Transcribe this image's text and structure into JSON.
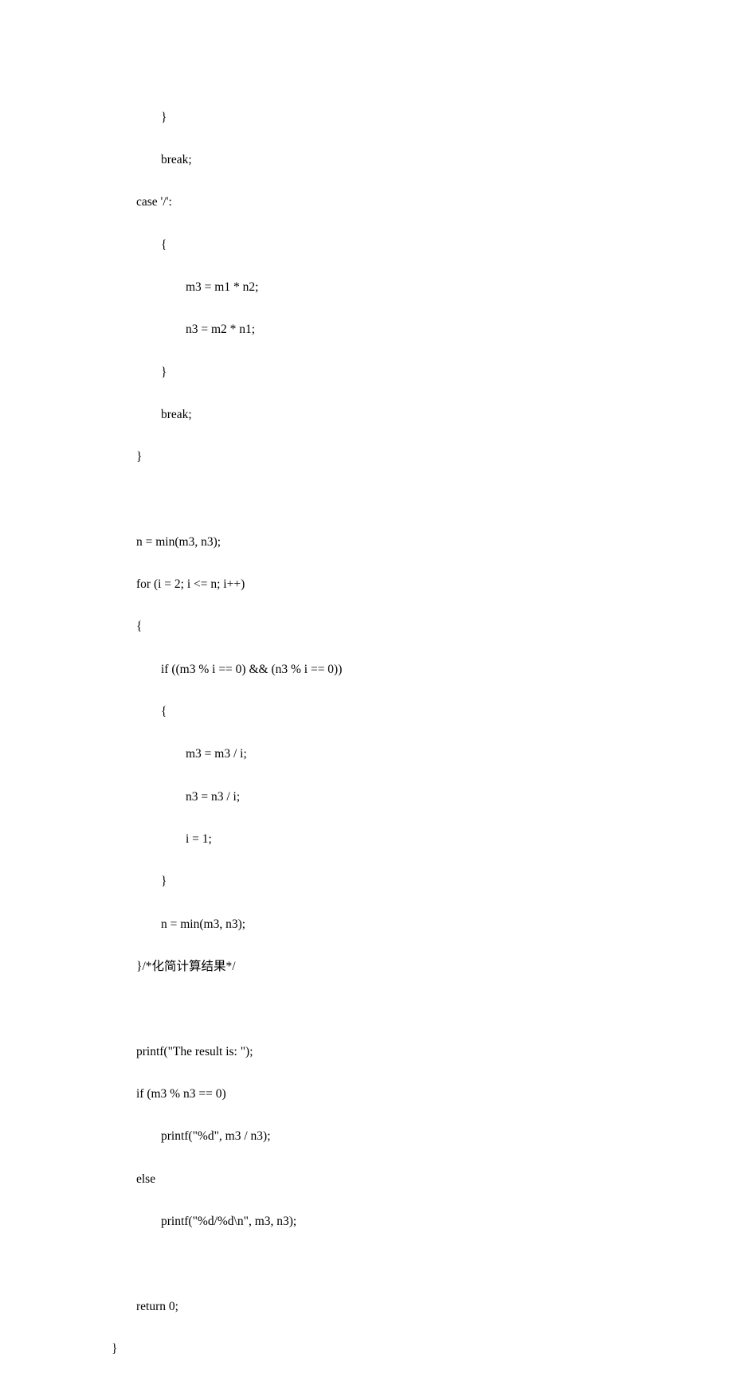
{
  "code": {
    "l1": "                }",
    "l2": "                break;",
    "l3": "        case '/':",
    "l4": "                {",
    "l5": "                        m3 = m1 * n2;",
    "l6": "                        n3 = m2 * n1;",
    "l7": "                }",
    "l8": "                break;",
    "l9": "        }",
    "l10": "        n = min(m3, n3);",
    "l11": "        for (i = 2; i <= n; i++)",
    "l12": "        {",
    "l13": "                if ((m3 % i == 0) && (n3 % i == 0))",
    "l14": "                {",
    "l15": "                        m3 = m3 / i;",
    "l16": "                        n3 = n3 / i;",
    "l17": "                        i = 1;",
    "l18": "                }",
    "l19": "                n = min(m3, n3);",
    "l20": "        }/*化简计算结果*/",
    "l21": "        printf(\"The result is: \");",
    "l22": "        if (m3 % n3 == 0)",
    "l23": "                printf(\"%d\", m3 / n3);",
    "l24": "        else",
    "l25": "                printf(\"%d/%d\\n\", m3, n3);",
    "l26": "        return 0;",
    "l27": "}"
  }
}
